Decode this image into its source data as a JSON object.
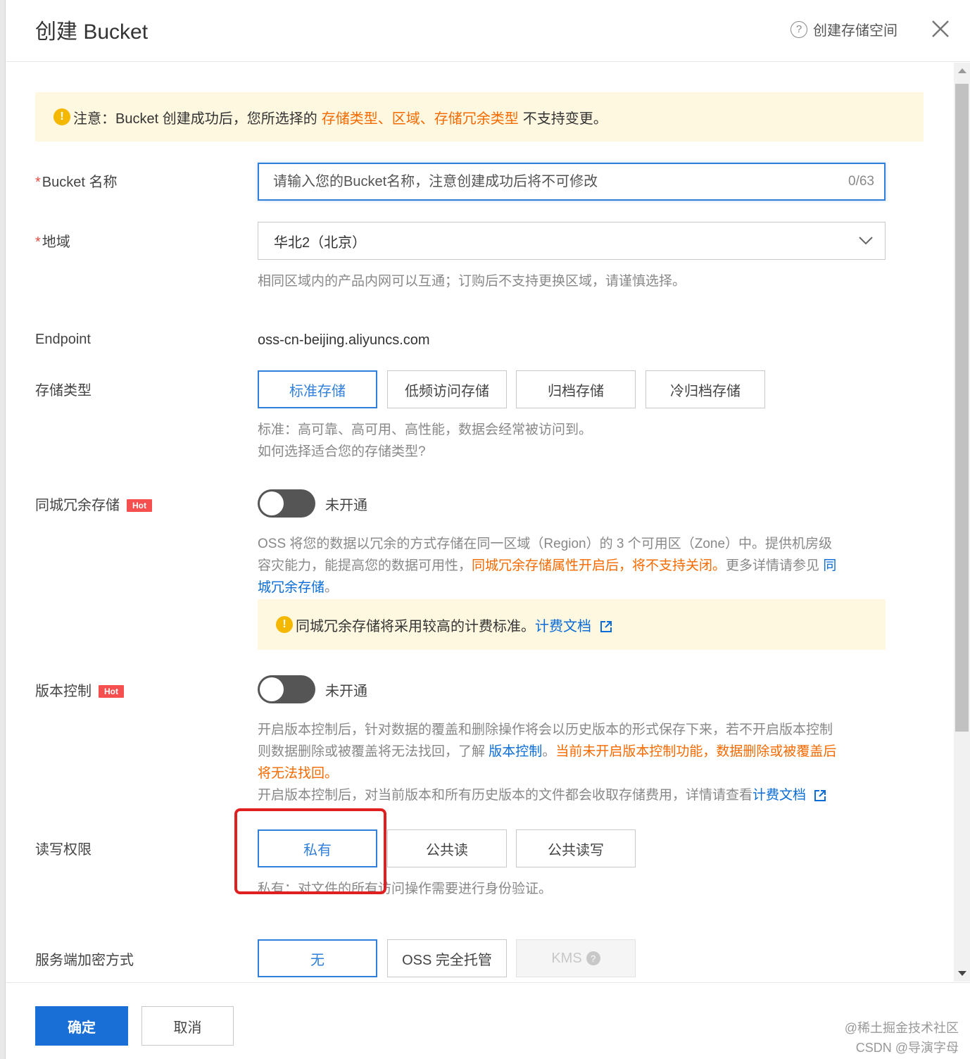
{
  "dialog": {
    "title": "创建 Bucket",
    "help_link": "创建存储空间",
    "help_icon": "?"
  },
  "notice": {
    "icon": "!",
    "prefix": "注意：Bucket 创建成功后，您所选择的",
    "highlights": "存储类型、区域、存储冗余类型",
    "suffix": "不支持变更。"
  },
  "bucket_name": {
    "required_mark": "*",
    "label": "Bucket 名称",
    "placeholder": "请输入您的Bucket名称，注意创建成功后将不可修改",
    "value": "",
    "counter": "0/63"
  },
  "region": {
    "required_mark": "*",
    "label": "地域",
    "selected": "华北2（北京）",
    "help": "相同区域内的产品内网可以互通；订购后不支持更换区域，请谨慎选择。"
  },
  "endpoint": {
    "label": "Endpoint",
    "value": "oss-cn-beijing.aliyuncs.com"
  },
  "storage_type": {
    "label": "存储类型",
    "options": [
      "标准存储",
      "低频访问存储",
      "归档存储",
      "冷归档存储"
    ],
    "selected_index": 0,
    "help": "标准：高可靠、高可用、高性能，数据会经常被访问到。",
    "link": "如何选择适合您的存储类型?"
  },
  "zone_redundant": {
    "label": "同城冗余存储",
    "badge": "Hot",
    "toggle_label": "未开通",
    "toggle_on": false,
    "desc_line1": "OSS 将您的数据以冗余的方式存储在同一区域（Region）的 3 个可用区（Zone）中。提供机房级",
    "desc_line2_a": "容灾能力，能提高您的数据可用性，",
    "desc_line2_warn": "同城冗余存储属性开启后，将不支持关闭。",
    "desc_line2_b": "更多详情请参见",
    "desc_link_a": "同",
    "desc_link_b": "城冗余存储",
    "desc_end": "。",
    "warn_icon": "!",
    "warn_text": "同城冗余存储将采用较高的计费标准。",
    "warn_link": "计费文档"
  },
  "versioning": {
    "label": "版本控制",
    "badge": "Hot",
    "toggle_label": "未开通",
    "toggle_on": false,
    "desc_line1": "开启版本控制后，针对数据的覆盖和删除操作将会以历史版本的形式保存下来，若不开启版本控制",
    "desc_line2_a": "则数据删除或被覆盖将无法找回，了解",
    "desc_link": "版本控制",
    "desc_line2_b": "。",
    "desc_warn_a": "当前未开启版本控制功能，数据删除或被覆盖后",
    "desc_warn_b": "将无法找回。",
    "desc_line4": "开启版本控制后，对当前版本和所有历史版本的文件都会收取存储费用，详情请查看",
    "desc_link2": "计费文档"
  },
  "acl": {
    "label": "读写权限",
    "options": [
      "私有",
      "公共读",
      "公共读写"
    ],
    "selected_index": 0,
    "help": "私有：对文件的所有访问操作需要进行身份验证。"
  },
  "encryption": {
    "label": "服务端加密方式",
    "options": [
      "无",
      "OSS 完全托管",
      "KMS"
    ],
    "selected_index": 0,
    "kms_info_icon": "?"
  },
  "footer": {
    "confirm": "确定",
    "cancel": "取消"
  },
  "watermarks": [
    "@稀土掘金技术社区",
    "CSDN @导演字母"
  ],
  "colors": {
    "primary": "#1a6fd6",
    "warning_orange": "#f56a00",
    "notice_bg": "#fff8e1",
    "hot_badge": "#f5504f",
    "highlight_box": "#e02020"
  }
}
